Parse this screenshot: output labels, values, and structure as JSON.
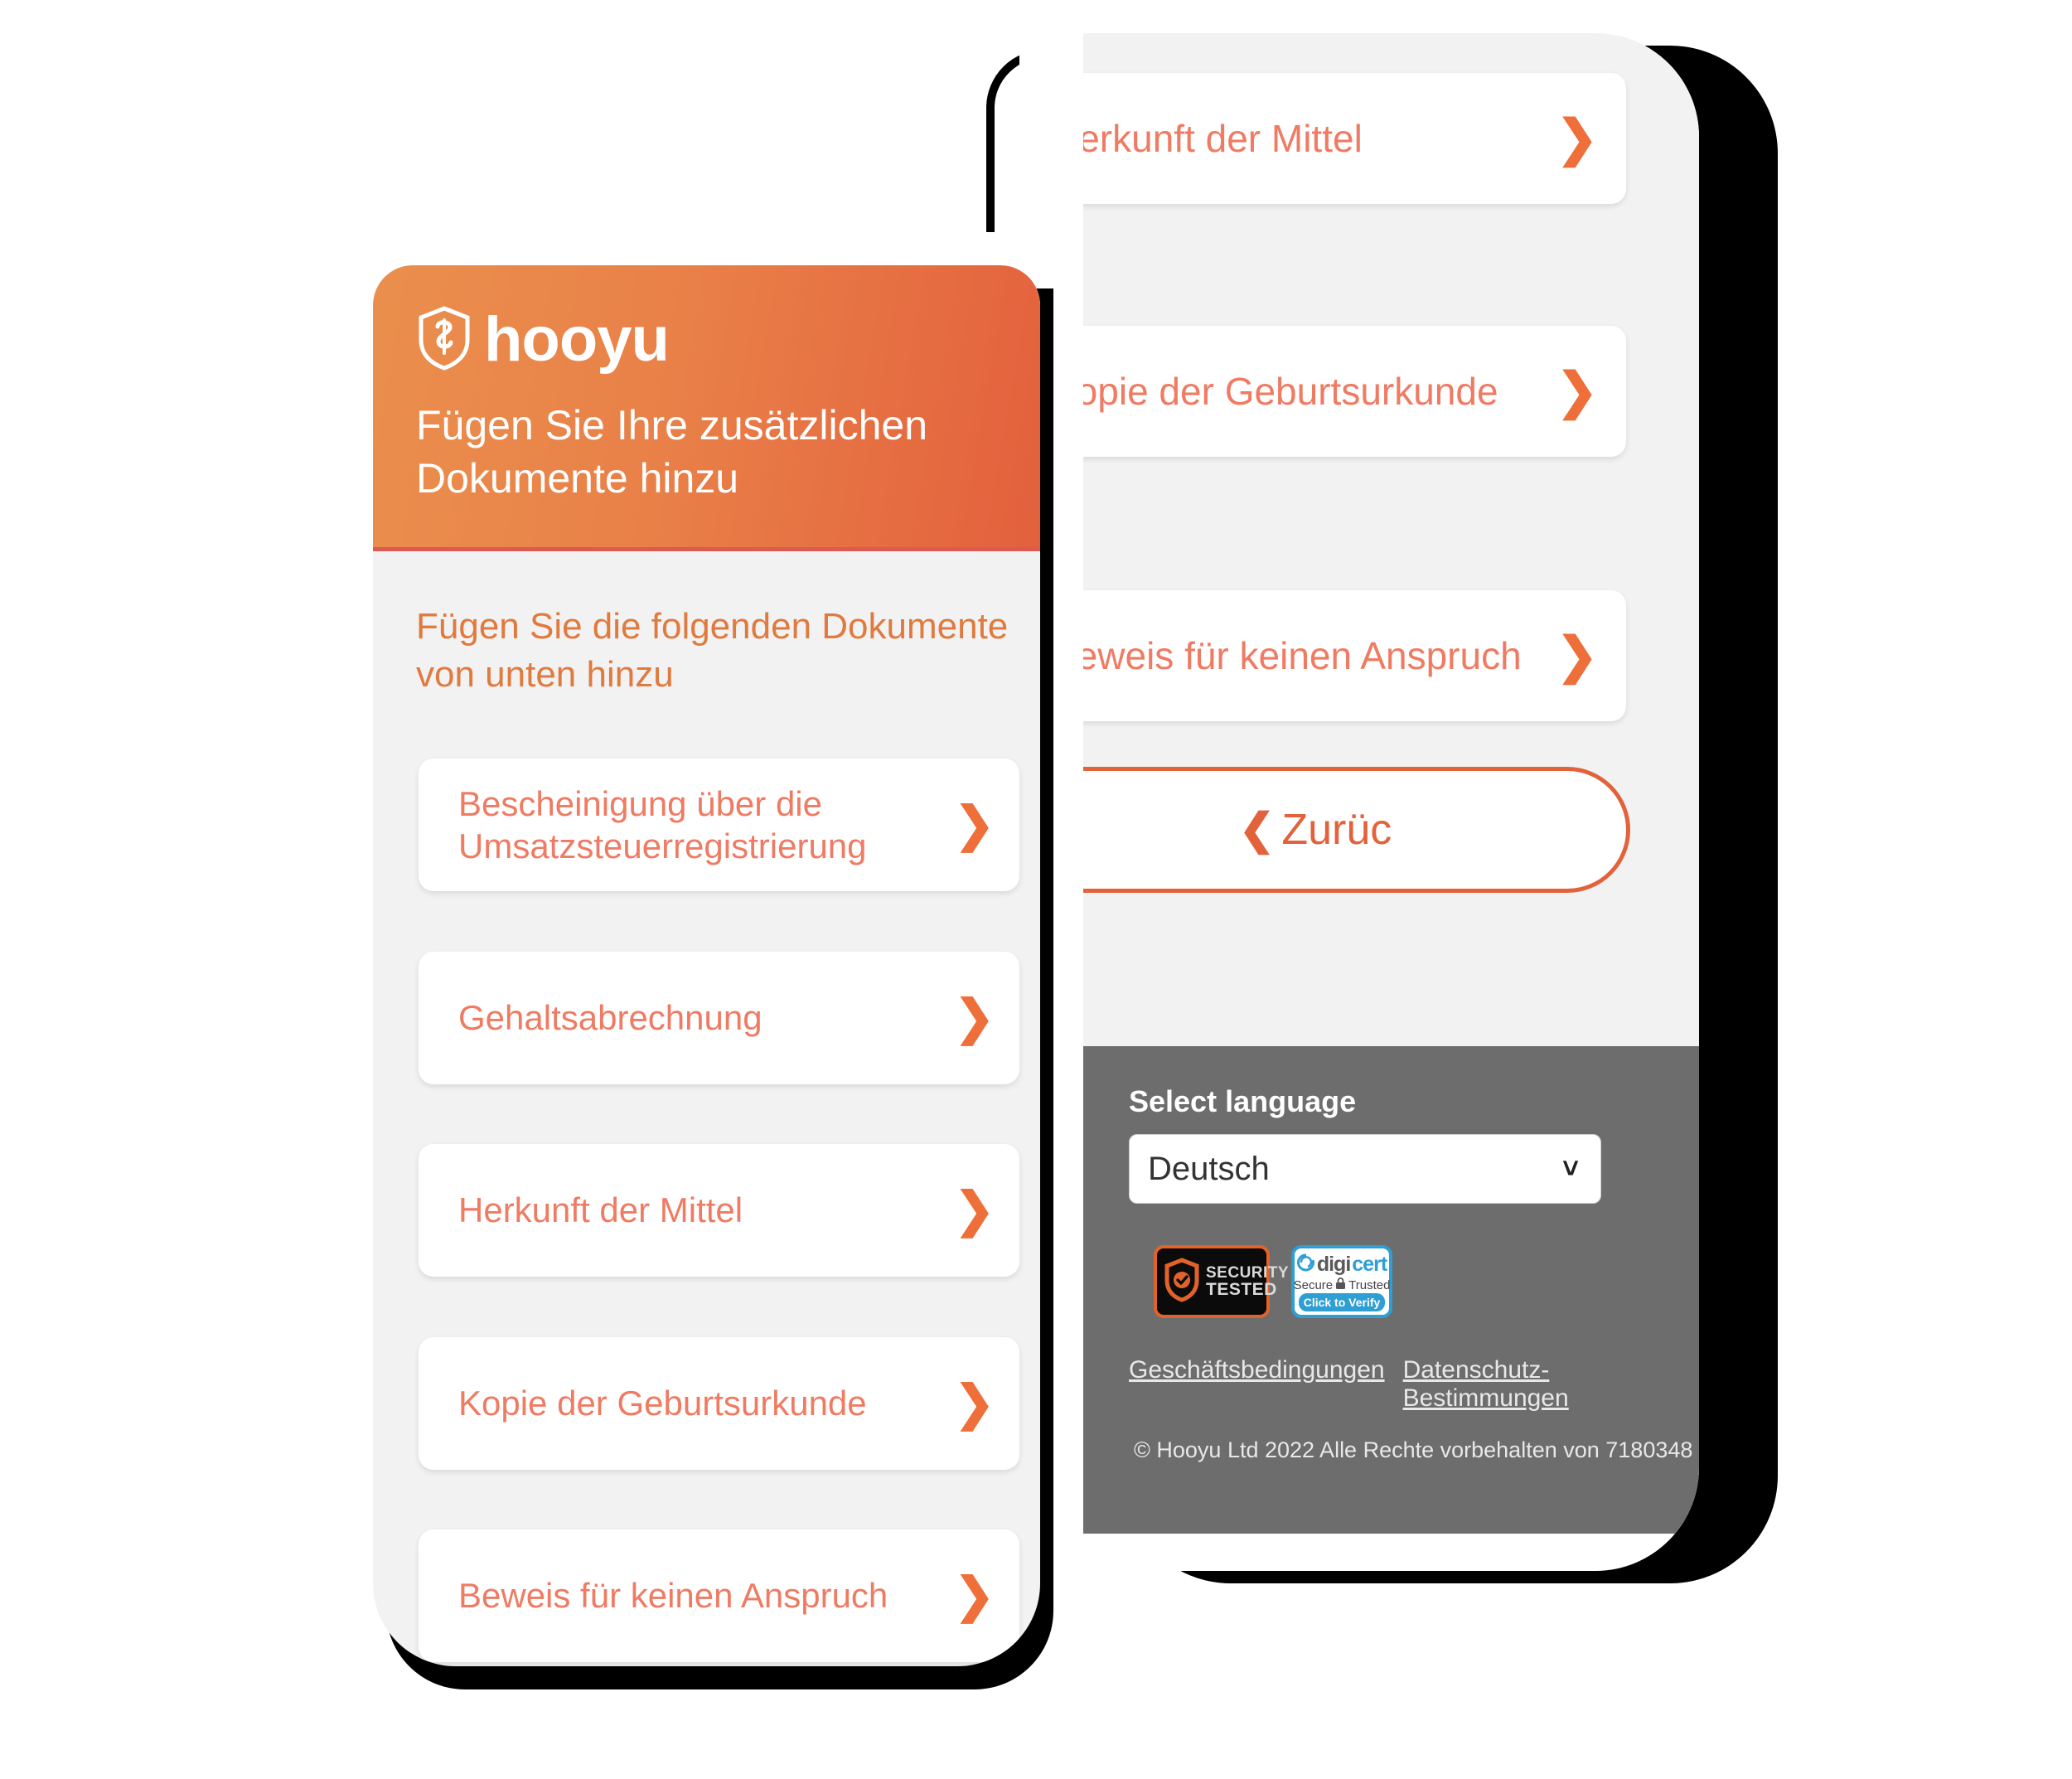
{
  "brand": {
    "name": "hooyu",
    "logo_icon": "shield-icon",
    "accent": "#e2623c",
    "header_gradient_from": "#ea8f4d",
    "header_gradient_to": "#e3603d",
    "link_text_color": "#ef7b63"
  },
  "front_phone": {
    "header": {
      "logo_text": "hooyu",
      "title": "Fügen Sie Ihre zusätzlichen Dokumente hinzu"
    },
    "subtitle": "Fügen Sie die folgenden Dokumente von unten hinzu",
    "document_items": [
      {
        "label": "Bescheinigung über die Umsatzsteuerregistrierung",
        "chevron": "chevron-right-icon"
      },
      {
        "label": "Gehaltsabrechnung",
        "chevron": "chevron-right-icon"
      },
      {
        "label": "Herkunft der Mittel",
        "chevron": "chevron-right-icon"
      },
      {
        "label": "Kopie der Geburtsurkunde",
        "chevron": "chevron-right-icon"
      },
      {
        "label": "Beweis für keinen Anspruch",
        "chevron": "chevron-right-icon"
      }
    ]
  },
  "back_phone": {
    "document_items": [
      {
        "label": "Herkunft der Mittel",
        "chevron": "chevron-right-icon"
      },
      {
        "label": "Kopie der Geburtsurkunde",
        "chevron": "chevron-right-icon"
      },
      {
        "label": "Beweis für keinen Anspruch",
        "chevron": "chevron-right-icon"
      }
    ],
    "back_button": {
      "label": "Zurüc",
      "chevron": "chevron-left-icon"
    },
    "footer": {
      "language_label": "Select language",
      "language_value": "Deutsch",
      "language_caret": "chevron-down-icon",
      "badges": [
        {
          "id": "security-tested",
          "line1": "SECURITY",
          "line2": "TESTED",
          "icon": "shield-check-icon",
          "border_color": "#e2632a",
          "background": "#0b0b0b"
        },
        {
          "id": "digicert",
          "word1": "digi",
          "word2": "cert",
          "sub_left": "Secure",
          "sub_right": "Trusted",
          "sub_icon": "lock-icon",
          "cta": "Click to Verify",
          "border_color": "#2e9fd4"
        }
      ],
      "links": [
        {
          "label": "Geschäftsbedingungen"
        },
        {
          "label": "Datenschutz-Bestimmungen"
        }
      ],
      "copyright": "© Hooyu Ltd 2022 Alle Rechte vorbehalten von 7180348"
    }
  }
}
